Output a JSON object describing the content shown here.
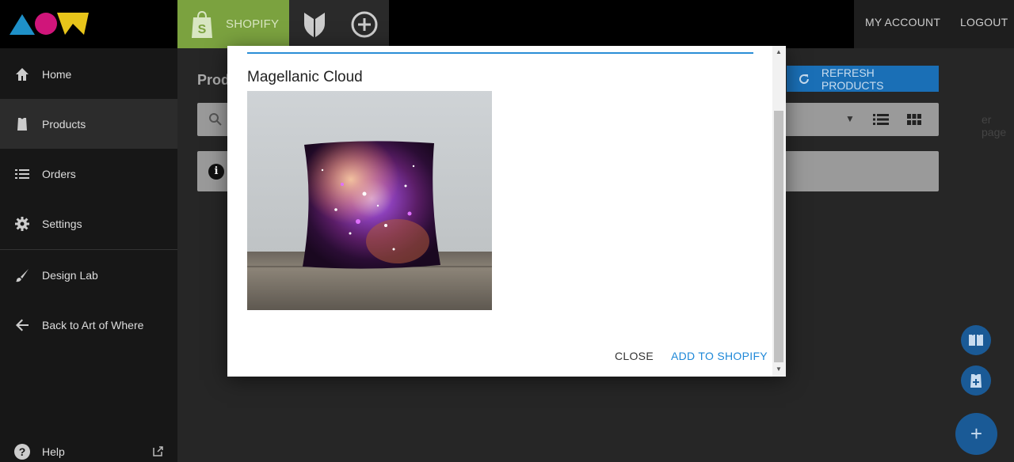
{
  "topbar": {
    "shopify_label": "SHOPIFY",
    "my_account": "MY ACCOUNT",
    "logout": "LOGOUT"
  },
  "sidebar": {
    "items": [
      {
        "label": "Home",
        "icon": "home-icon"
      },
      {
        "label": "Products",
        "icon": "shirt-icon"
      },
      {
        "label": "Orders",
        "icon": "list-icon"
      },
      {
        "label": "Settings",
        "icon": "gear-icon"
      },
      {
        "label": "Design Lab",
        "icon": "brush-icon"
      },
      {
        "label": "Back to Art of Where",
        "icon": "arrow-left-icon"
      }
    ],
    "help": "Help"
  },
  "main": {
    "page_title": "Prod",
    "per_page": "er page",
    "refresh_label": "REFRESH PRODUCTS"
  },
  "modal": {
    "title": "Magellanic Cloud",
    "close_label": "CLOSE",
    "add_label": "ADD TO SHOPIFY"
  },
  "colors": {
    "accent_blue": "#1e88d8",
    "shopify_green": "#7ba23f"
  }
}
